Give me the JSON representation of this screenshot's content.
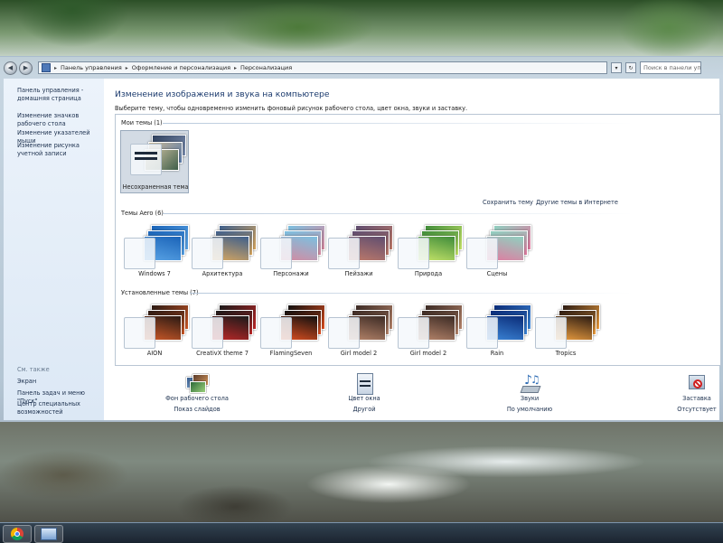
{
  "addressbar": {
    "crumbs": [
      "Панель управления",
      "Оформление и персонализация",
      "Персонализация"
    ],
    "search_placeholder": "Поиск в панели упр..."
  },
  "sidebar": {
    "links": [
      "Панель управления - домашняя страница",
      "Изменение значков рабочего стола",
      "Изменение указателей мыши",
      "Изменение рисунка учетной записи"
    ],
    "see_also_label": "См. также",
    "see_also_links": [
      "Экран",
      "Панель задач и меню \"Пуск\"",
      "Центр специальных возможностей"
    ]
  },
  "content": {
    "heading": "Изменение изображения и звука на компьютере",
    "subheading": "Выберите тему, чтобы одновременно изменить фоновый рисунок рабочего стола, цвет окна, звуки и заставку.",
    "my_themes": {
      "label": "Мои темы (1)",
      "items": [
        {
          "name": "Несохраненная тема",
          "selected": true
        }
      ],
      "save_link": "Сохранить тему",
      "online_link": "Другие темы в Интернете"
    },
    "aero_themes": {
      "label": "Темы Aero (6)",
      "items": [
        {
          "name": "Windows 7",
          "colors": [
            "#1b64b8",
            "#5aa4e6"
          ]
        },
        {
          "name": "Архитектура",
          "colors": [
            "#3e5f8c",
            "#d9a860"
          ]
        },
        {
          "name": "Персонажи",
          "colors": [
            "#7cc0e0",
            "#d68aa0"
          ]
        },
        {
          "name": "Пейзажи",
          "colors": [
            "#5f4d70",
            "#c07b6a"
          ]
        },
        {
          "name": "Природа",
          "colors": [
            "#3f8c3a",
            "#c7e56a"
          ]
        },
        {
          "name": "Сцены",
          "colors": [
            "#8fd0c0",
            "#e27aa0"
          ]
        }
      ]
    },
    "installed_themes": {
      "label": "Установленные темы (7)",
      "items": [
        {
          "name": "AION",
          "colors": [
            "#2a1a14",
            "#d05a28"
          ]
        },
        {
          "name": "CreativX theme 7",
          "colors": [
            "#1a1a1a",
            "#c02828"
          ]
        },
        {
          "name": "FlamingSeven",
          "colors": [
            "#0f0f0f",
            "#e05020"
          ]
        },
        {
          "name": "Girl model 2",
          "colors": [
            "#3b2a24",
            "#b8866c"
          ]
        },
        {
          "name": "Girl model 2",
          "colors": [
            "#3b2a24",
            "#b8866c"
          ]
        },
        {
          "name": "Rain",
          "colors": [
            "#0b2c78",
            "#3c86d8"
          ]
        },
        {
          "name": "Tropics",
          "colors": [
            "#2a1a12",
            "#f0a040"
          ]
        }
      ]
    }
  },
  "bottombar": [
    {
      "title": "Фон рабочего стола",
      "subtitle": "Показ слайдов",
      "icon": "desktop-background-icon"
    },
    {
      "title": "Цвет окна",
      "subtitle": "Другой",
      "icon": "window-color-icon"
    },
    {
      "title": "Звуки",
      "subtitle": "По умолчанию",
      "icon": "sounds-icon"
    },
    {
      "title": "Заставка",
      "subtitle": "Отсутствует",
      "icon": "screensaver-icon"
    }
  ],
  "taskbar": {
    "apps": [
      "chrome-icon",
      "control-panel-icon"
    ]
  }
}
